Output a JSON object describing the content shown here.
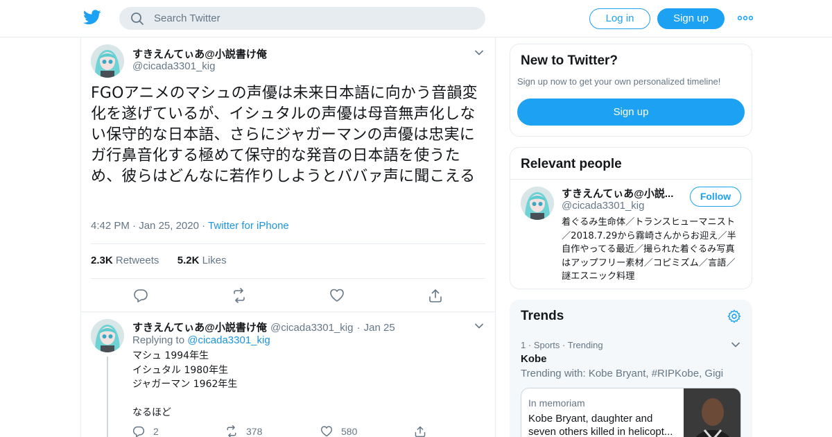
{
  "colors": {
    "accent": "#1da1f2",
    "link": "#1b95e0",
    "muted": "#657786",
    "border": "#e6ecf0"
  },
  "header": {
    "logo_icon": "twitter-bird-icon",
    "search_placeholder": "Search Twitter",
    "login_label": "Log in",
    "signup_label": "Sign up",
    "more_icon": "more-dots-icon"
  },
  "tweet": {
    "author_name": "すきえんてぃあ@小説書け俺",
    "author_handle": "@cicada3301_kig",
    "text": "FGOアニメのマシュの声優は未来日本語に向かう音韻変化を遂げているが、イシュタルの声優は母音無声化しない保守的な日本語、さらにジャガーマンの声優は忠実にガ行鼻音化する極めて保守的な発音の日本語を使うため、彼らはどんなに若作りしようとババァ声に聞こえる",
    "time": "4:42 PM",
    "date": "Jan 25, 2020",
    "source": "Twitter for iPhone",
    "retweets_count": "2.3K",
    "retweets_label": "Retweets",
    "likes_count": "5.2K",
    "likes_label": "Likes"
  },
  "reply": {
    "author_name": "すきえんてぃあ@小説書け俺",
    "author_handle": "@cicada3301_kig",
    "date": "Jan 25",
    "replying_prefix": "Replying to",
    "replying_handle": "@cicada3301_kig",
    "body": "マシュ 1994年生\nイシュタル 1980年生\nジャガーマン 1962年生\n\nなるほど",
    "reply_count": "2",
    "retweet_count": "378",
    "like_count": "580"
  },
  "new_to_twitter": {
    "title": "New to Twitter?",
    "subtitle": "Sign up now to get your own personalized timeline!",
    "signup_label": "Sign up"
  },
  "relevant_people": {
    "title": "Relevant people",
    "name": "すきえんてぃあ@小説...",
    "handle": "@cicada3301_kig",
    "follow_label": "Follow",
    "bio": "着ぐるみ生命体／トランスヒューマニスト／2018.7.29から霧崎さんからお迎え／半自作やってる最近／撮られた着ぐるみ写真はアップフリー素材／コピミズム／言語／謎エスニック料理"
  },
  "trends": {
    "title": "Trends",
    "rank": "1",
    "category": "Sports",
    "status": "Trending",
    "name": "Kobe",
    "trending_with": "Trending with: Kobe Bryant, #RIPKobe, Gigi",
    "card_label": "In memoriam",
    "card_text": "Kobe Bryant, daughter and seven others killed in helicopt..."
  }
}
